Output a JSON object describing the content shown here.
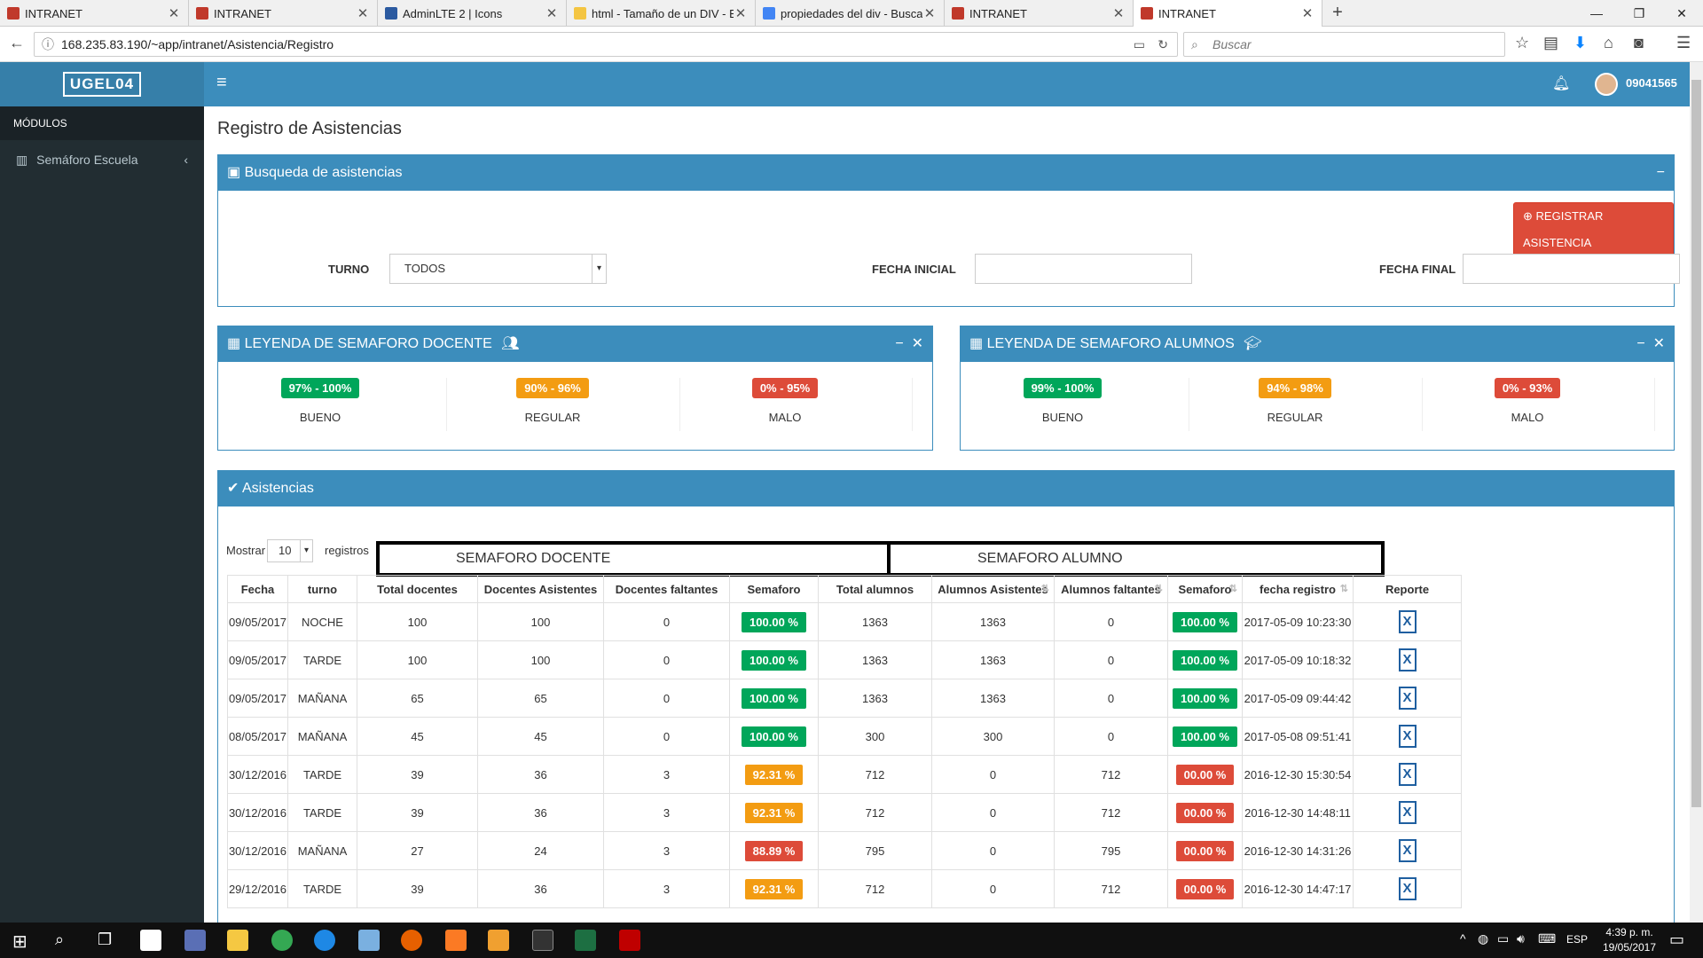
{
  "browser": {
    "tabs": [
      {
        "label": "INTRANET"
      },
      {
        "label": "INTRANET"
      },
      {
        "label": "AdminLTE 2 | Icons"
      },
      {
        "label": "html - Tamaño de un DIV - E"
      },
      {
        "label": "propiedades del div - Buscar"
      },
      {
        "label": "INTRANET"
      },
      {
        "label": "INTRANET"
      }
    ],
    "url": "168.235.83.190/~app/intranet/Asistencia/Registro",
    "search_placeholder": "Buscar"
  },
  "app": {
    "logo": "UGEL04",
    "menu_header": "MÓDULOS",
    "menu_item": "Semáforo Escuela",
    "user": "09041565",
    "page_title": "Registro de Asistencias"
  },
  "search_box": {
    "title": "Busqueda de asistencias",
    "register_button": "REGISTRAR ASISTENCIA",
    "turno_label": "TURNO",
    "turno_value": "TODOS",
    "fecha_inicial_label": "FECHA INICIAL",
    "fecha_final_label": "FECHA FINAL"
  },
  "legend_docente": {
    "title": "LEYENDA DE SEMAFORO DOCENTE",
    "items": [
      {
        "range": "97% - 100%",
        "label": "BUENO",
        "color": "#00a65a"
      },
      {
        "range": "90% - 96%",
        "label": "REGULAR",
        "color": "#f39c12"
      },
      {
        "range": "0% - 95%",
        "label": "MALO",
        "color": "#dd4b39"
      }
    ]
  },
  "legend_alumnos": {
    "title": "LEYENDA DE SEMAFORO ALUMNOS",
    "items": [
      {
        "range": "99% - 100%",
        "label": "BUENO",
        "color": "#00a65a"
      },
      {
        "range": "94% - 98%",
        "label": "REGULAR",
        "color": "#f39c12"
      },
      {
        "range": "0% - 93%",
        "label": "MALO",
        "color": "#dd4b39"
      }
    ]
  },
  "asistencias": {
    "title": "Asistencias",
    "show_label": "Mostrar",
    "show_value": "10",
    "records_label": "registros",
    "group_docente": "SEMAFORO DOCENTE",
    "group_alumno": "SEMAFORO ALUMNO",
    "columns": [
      "Fecha",
      "turno",
      "Total docentes",
      "Docentes Asistentes",
      "Docentes faltantes",
      "Semaforo",
      "Total alumnos",
      "Alumnos Asistentes",
      "Alumnos faltantes",
      "Semaforo",
      "fecha registro",
      "Reporte"
    ],
    "rows": [
      [
        "09/05/2017",
        "NOCHE",
        "100",
        "100",
        "0",
        "100.00 %",
        "1363",
        "1363",
        "0",
        "100.00 %",
        "2017-05-09 10:23:30"
      ],
      [
        "09/05/2017",
        "TARDE",
        "100",
        "100",
        "0",
        "100.00 %",
        "1363",
        "1363",
        "0",
        "100.00 %",
        "2017-05-09 10:18:32"
      ],
      [
        "09/05/2017",
        "MAÑANA",
        "65",
        "65",
        "0",
        "100.00 %",
        "1363",
        "1363",
        "0",
        "100.00 %",
        "2017-05-09 09:44:42"
      ],
      [
        "08/05/2017",
        "MAÑANA",
        "45",
        "45",
        "0",
        "100.00 %",
        "300",
        "300",
        "0",
        "100.00 %",
        "2017-05-08 09:51:41"
      ],
      [
        "30/12/2016",
        "TARDE",
        "39",
        "36",
        "3",
        "92.31 %",
        "712",
        "0",
        "712",
        "00.00 %",
        "2016-12-30 15:30:54"
      ],
      [
        "30/12/2016",
        "TARDE",
        "39",
        "36",
        "3",
        "92.31 %",
        "712",
        "0",
        "712",
        "00.00 %",
        "2016-12-30 14:48:11"
      ],
      [
        "30/12/2016",
        "MAÑANA",
        "27",
        "24",
        "3",
        "88.89 %",
        "795",
        "0",
        "795",
        "00.00 %",
        "2016-12-30 14:31:26"
      ],
      [
        "29/12/2016",
        "TARDE",
        "39",
        "36",
        "3",
        "92.31 %",
        "712",
        "0",
        "712",
        "00.00 %",
        "2016-12-30 14:47:17"
      ]
    ],
    "pill_colors": {
      "100.00 %": "#00a65a",
      "92.31 %": "#f39c12",
      "88.89 %": "#dd4b39",
      "00.00 %": "#dd4b39"
    },
    "report_icon": "X"
  },
  "taskbar": {
    "lang": "ESP",
    "time": "4:39 p. m.",
    "date": "19/05/2017"
  }
}
